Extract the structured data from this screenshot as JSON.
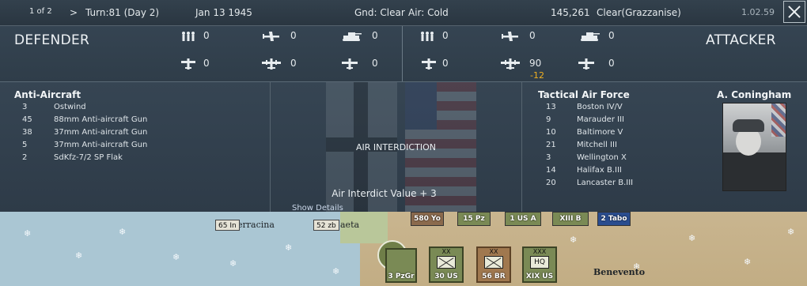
{
  "topbar": {
    "page": "1 of 2",
    "next_glyph": ">",
    "turn": "Turn:81 (Day 2)",
    "date": "Jan 13 1945",
    "ground": "Gnd: Clear",
    "air": "Air: Cold",
    "location": "145,261",
    "terrain": "Clear(Grazzanise)",
    "version": "1.02.59"
  },
  "defender": {
    "title": "DEFENDER",
    "stats": {
      "infantry": "0",
      "fighter": "0",
      "tank": "0",
      "small_plane": "0",
      "bomber": "0",
      "transport": "0"
    }
  },
  "attacker": {
    "title": "ATTACKER",
    "stats": {
      "infantry": "0",
      "fighter": "0",
      "tank": "0",
      "small_plane": "0",
      "bomber": "90",
      "bomber_loss": "-12",
      "transport": "0"
    }
  },
  "anti_aircraft": {
    "title": "Anti-Aircraft",
    "rows": [
      {
        "count": "3",
        "name": "Ostwind"
      },
      {
        "count": "45",
        "name": "88mm Anti-aircraft Gun"
      },
      {
        "count": "38",
        "name": "37mm Anti-aircraft Gun"
      },
      {
        "count": "5",
        "name": "37mm Anti-aircraft Gun"
      },
      {
        "count": "2",
        "name": "SdKfz-7/2 SP Flak"
      }
    ]
  },
  "middle": {
    "mission": "AIR INTERDICTION",
    "interdict_value": "Air Interdict Value  + 3",
    "show_details": "Show Details"
  },
  "air_force": {
    "title": "Tactical Air Force",
    "commander": "A. Coningham",
    "rows": [
      {
        "count": "13",
        "name": "Boston IV/V"
      },
      {
        "count": "9",
        "name": "Marauder III"
      },
      {
        "count": "10",
        "name": "Baltimore V"
      },
      {
        "count": "21",
        "name": "Mitchell III"
      },
      {
        "count": "3",
        "name": "Wellington X"
      },
      {
        "count": "14",
        "name": "Halifax B.III"
      },
      {
        "count": "20",
        "name": "Lancaster B.III"
      }
    ]
  },
  "map": {
    "places": [
      "erracina",
      "aeta",
      "Benevento"
    ],
    "units": [
      "65 In",
      "52 zb",
      "580 Yo",
      "15 Pz",
      "1 US A",
      "XIII B",
      "2 Tabo",
      "3 PzGr",
      "30 US",
      "56 BR",
      "XIX US"
    ],
    "sizes": [
      "XX",
      "XX",
      "XXX"
    ],
    "hq_label": "HQ"
  },
  "colors": {
    "loss": "#f0b020",
    "panel": "#354452"
  }
}
